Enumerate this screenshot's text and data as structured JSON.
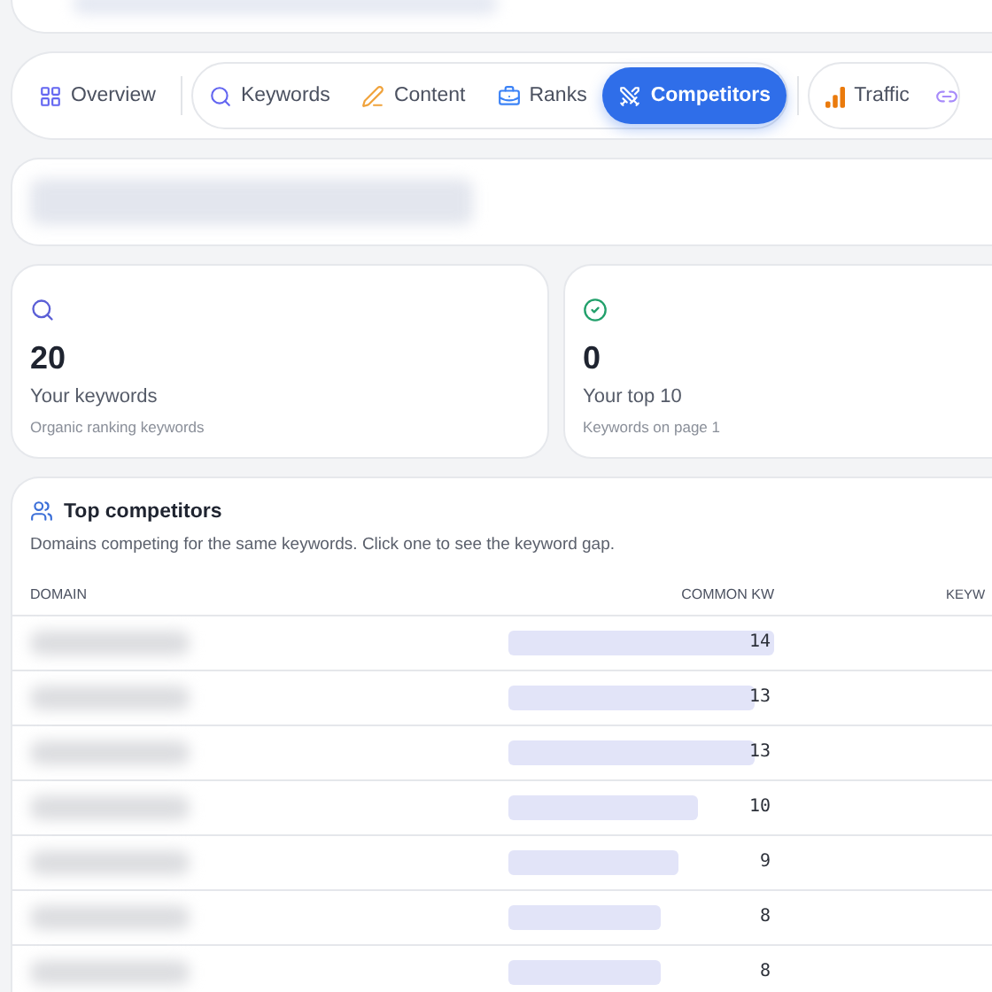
{
  "nav": {
    "groups": [
      {
        "kind": "plain",
        "tabs": [
          {
            "label": "Overview",
            "selected": false
          }
        ]
      },
      {
        "kind": "pill",
        "tabs": [
          {
            "label": "Keywords",
            "selected": false
          },
          {
            "label": "Content",
            "selected": false
          },
          {
            "label": "Ranks",
            "selected": false
          },
          {
            "label": "Competitors",
            "selected": true
          }
        ]
      },
      {
        "kind": "pill",
        "tabs": [
          {
            "label": "Traffic",
            "selected": false
          }
        ]
      }
    ]
  },
  "stats": [
    {
      "value": "20",
      "label": "Your keywords",
      "hint": "Organic ranking keywords"
    },
    {
      "value": "0",
      "label": "Your top 10",
      "hint": "Keywords on page 1"
    }
  ],
  "competitors": {
    "title": "Top competitors",
    "subtitle": "Domains competing for the same keywords. Click one to see the keyword gap.",
    "columns": [
      "DOMAIN",
      "COMMON KW",
      "KEYW"
    ],
    "rows": [
      {
        "common": "14"
      },
      {
        "common": "13"
      },
      {
        "common": "13"
      },
      {
        "common": "10"
      },
      {
        "common": "9"
      },
      {
        "common": "8"
      },
      {
        "common": "8"
      }
    ]
  }
}
